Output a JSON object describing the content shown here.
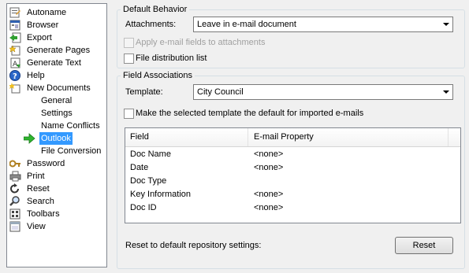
{
  "tree": {
    "items": [
      {
        "label": "Autoname",
        "icon": "autoname-icon"
      },
      {
        "label": "Browser",
        "icon": "browser-icon"
      },
      {
        "label": "Export",
        "icon": "export-icon"
      },
      {
        "label": "Generate Pages",
        "icon": "generate-pages-icon"
      },
      {
        "label": "Generate Text",
        "icon": "generate-text-icon"
      },
      {
        "label": "Help",
        "icon": "help-icon"
      },
      {
        "label": "New Documents",
        "icon": "new-documents-icon"
      },
      {
        "label": "General"
      },
      {
        "label": "Settings"
      },
      {
        "label": "Name Conflicts"
      },
      {
        "label": "Outlook",
        "icon": "green-arrow-icon",
        "selected": true
      },
      {
        "label": "File Conversion"
      },
      {
        "label": "Password",
        "icon": "password-icon"
      },
      {
        "label": "Print",
        "icon": "print-icon"
      },
      {
        "label": "Reset",
        "icon": "reset-icon"
      },
      {
        "label": "Search",
        "icon": "search-icon"
      },
      {
        "label": "Toolbars",
        "icon": "toolbars-icon"
      },
      {
        "label": "View",
        "icon": "view-icon"
      }
    ]
  },
  "default_behavior": {
    "title": "Default Behavior",
    "attachments_label": "Attachments:",
    "attachments_value": "Leave in e-mail document",
    "apply_fields_label": "Apply e-mail fields to attachments",
    "file_distribution_label": "File distribution list"
  },
  "field_associations": {
    "title": "Field Associations",
    "template_label": "Template:",
    "template_value": "City Council",
    "make_default_label": "Make the selected template the default for imported e-mails",
    "columns": [
      "Field",
      "E-mail Property"
    ],
    "rows": [
      {
        "field": "Doc Name",
        "property": "<none>"
      },
      {
        "field": "Date",
        "property": "<none>"
      },
      {
        "field": "Doc Type",
        "property": ""
      },
      {
        "field": "Key Information",
        "property": "<none>"
      },
      {
        "field": "Doc ID",
        "property": "<none>"
      }
    ],
    "reset_label": "Reset to default repository settings:",
    "reset_button": "Reset"
  },
  "colors": {
    "selection": "#3399ff",
    "green_arrow": "#2fb52f"
  }
}
